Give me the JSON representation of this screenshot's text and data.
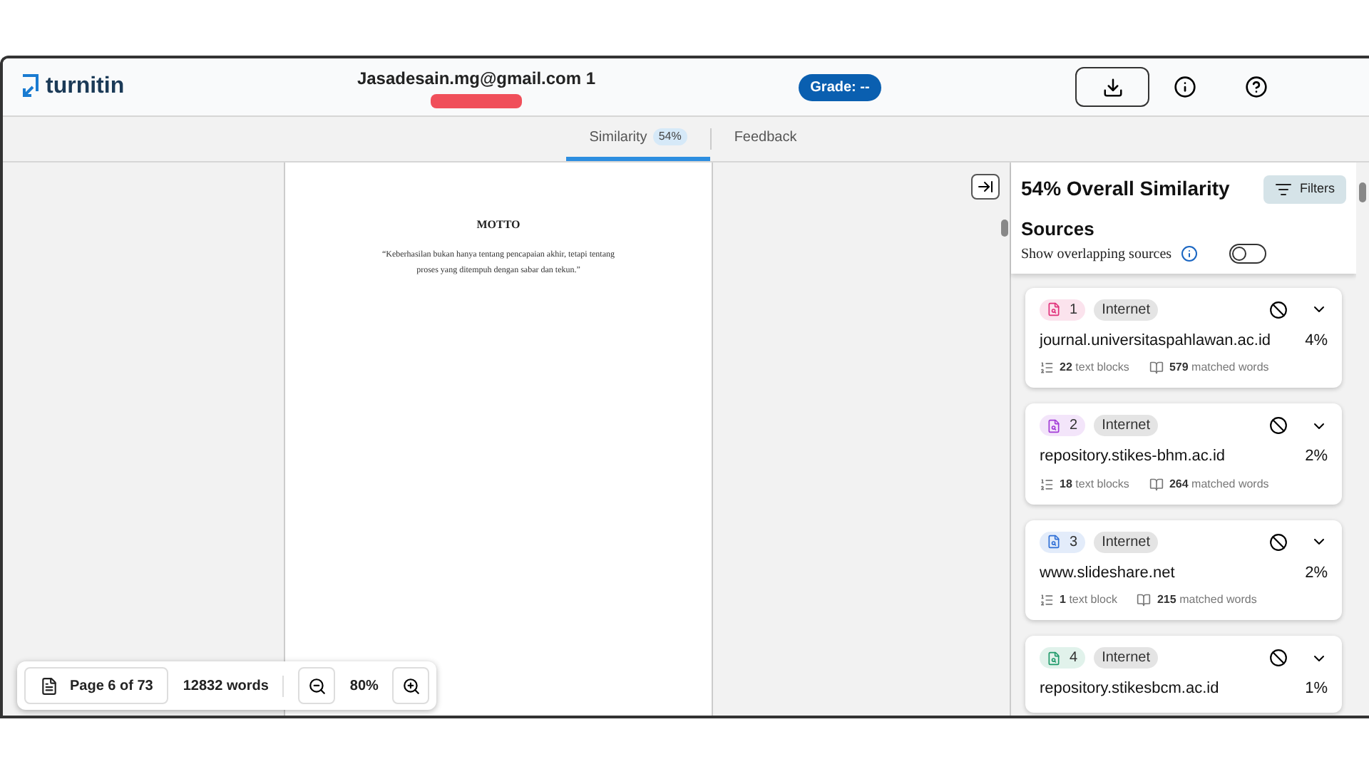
{
  "header": {
    "logo": "turnitin",
    "submission_title": "Jasadesain.mg@gmail.com 1",
    "grade": "Grade: --"
  },
  "tabs": [
    {
      "label": "Similarity",
      "badge": "54%",
      "selected": true
    },
    {
      "label": "Feedback",
      "selected": false
    }
  ],
  "document": {
    "heading": "MOTTO",
    "quote": "“Keberhasilan bukan hanya tentang pencapaian akhir, tetapi tentang proses yang ditempuh dengan sabar dan tekun.”"
  },
  "toolbar": {
    "page": "Page 6 of 73",
    "words": "12832 words",
    "zoom": "80%"
  },
  "panel": {
    "title": "54% Overall Similarity",
    "filters": "Filters",
    "sources_heading": "Sources",
    "overlap_label": "Show overlapping sources",
    "overlap_on": false,
    "sources": [
      {
        "number": "1",
        "type": "Internet",
        "name": "journal.universitaspahlawan.ac.id",
        "percent": "4%",
        "blocks": "22",
        "blocks_label": "text blocks",
        "matched": "579",
        "matched_label": "matched words",
        "color": "#e0307a"
      },
      {
        "number": "2",
        "type": "Internet",
        "name": "repository.stikes-bhm.ac.id",
        "percent": "2%",
        "blocks": "18",
        "blocks_label": "text blocks",
        "matched": "264",
        "matched_label": "matched words",
        "color": "#a23ad6"
      },
      {
        "number": "3",
        "type": "Internet",
        "name": "www.slideshare.net",
        "percent": "2%",
        "blocks": "1",
        "blocks_label": "text block",
        "matched": "215",
        "matched_label": "matched words",
        "color": "#2f6fd6"
      },
      {
        "number": "4",
        "type": "Internet",
        "name": "repository.stikesbcm.ac.id",
        "percent": "1%",
        "color": "#1f9a6a"
      }
    ]
  }
}
